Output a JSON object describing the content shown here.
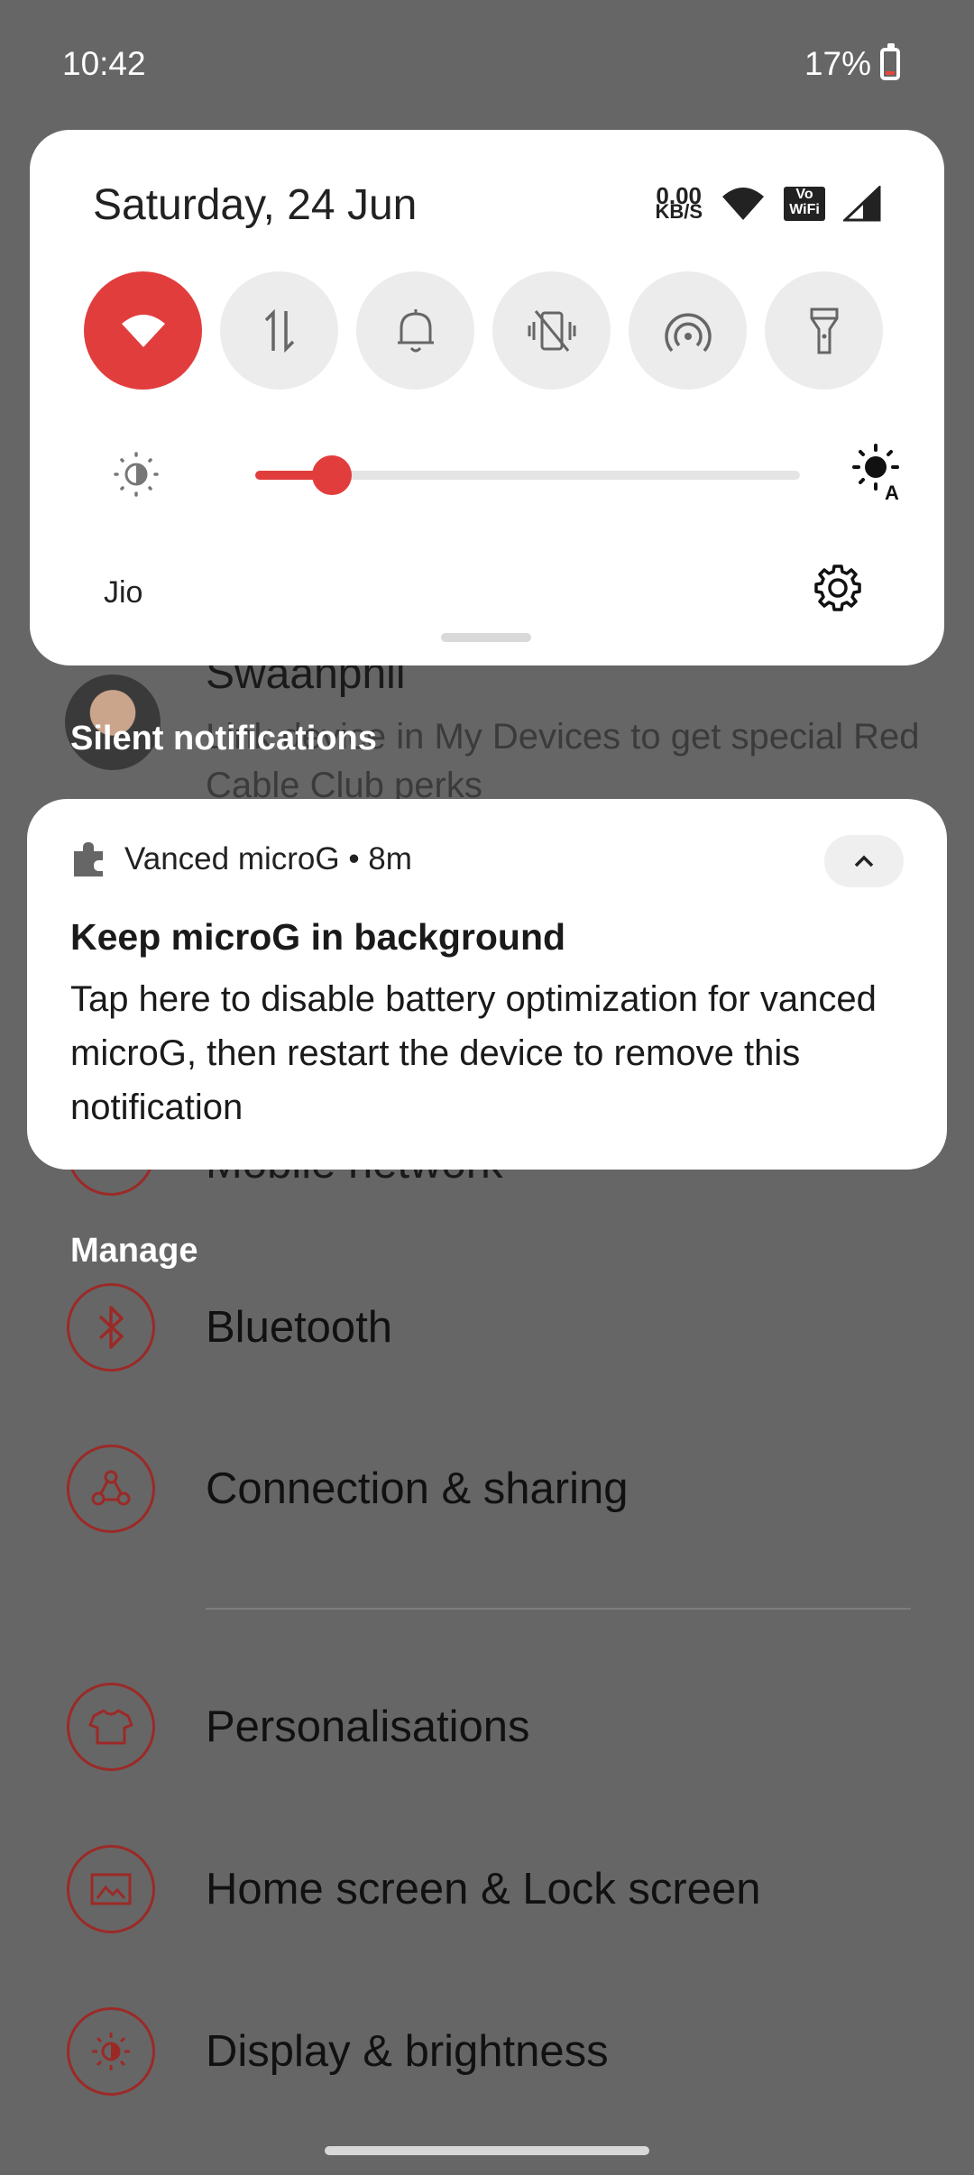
{
  "status_bar": {
    "time": "10:42",
    "battery_percent": "17%",
    "battery_level": 0.17
  },
  "quick_settings": {
    "date": "Saturday, 24 Jun",
    "net_speed_value": "0.00",
    "net_speed_unit": "KB/S",
    "volte_label_top": "Vo",
    "volte_label_bottom": "WiFi",
    "tiles": [
      {
        "icon": "wifi-icon",
        "active": true
      },
      {
        "icon": "mobile-data-icon",
        "active": false
      },
      {
        "icon": "bell-icon",
        "active": false
      },
      {
        "icon": "vibrate-off-icon",
        "active": false
      },
      {
        "icon": "hotspot-icon",
        "active": false
      },
      {
        "icon": "flashlight-icon",
        "active": false
      }
    ],
    "brightness_level": 0.14,
    "carrier": "Jio",
    "accent_color": "#e23d3d"
  },
  "background": {
    "profile_name": "Swaanphil",
    "profile_subtitle": "Link device in My Devices to get special Red Cable Club perks",
    "partial_item": "Mobile network",
    "silent_label": "Silent notifications",
    "manage_label": "Manage",
    "items": [
      {
        "label": "Bluetooth",
        "icon": "bluetooth-icon"
      },
      {
        "label": "Connection & sharing",
        "icon": "connection-sharing-icon"
      },
      {
        "label": "Personalisations",
        "icon": "tshirt-icon"
      },
      {
        "label": "Home screen & Lock screen",
        "icon": "image-icon"
      },
      {
        "label": "Display & brightness",
        "icon": "brightness-icon"
      }
    ]
  },
  "notification": {
    "app_name": "Vanced microG • 8m",
    "title": "Keep microG in background",
    "body": "Tap here to disable battery optimization for vanced microG, then restart the device to remove this notification"
  }
}
